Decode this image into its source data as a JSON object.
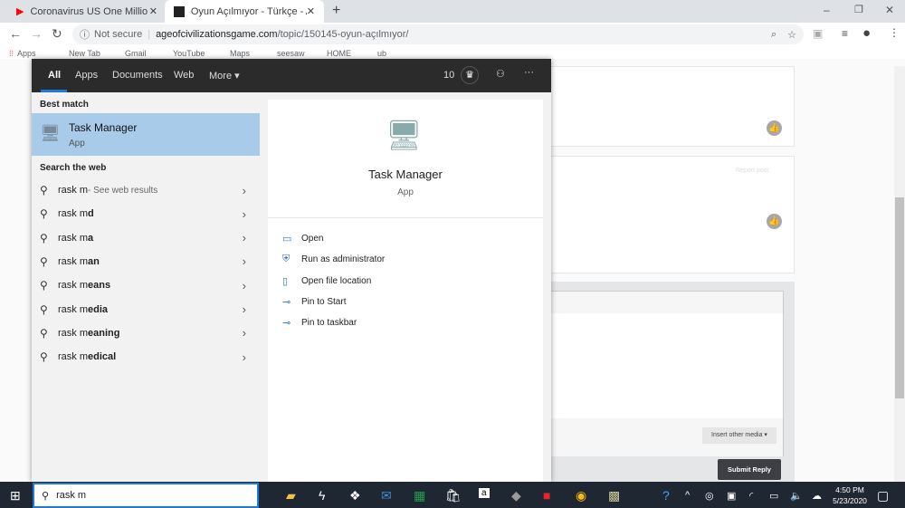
{
  "browser": {
    "tabs": [
      {
        "title": "Coronavirus US One Million Case",
        "icon": "youtube-icon",
        "active": false
      },
      {
        "title": "Oyun Açılmıyor - Türkçe - Age of",
        "icon": "game-icon",
        "active": true
      }
    ],
    "security": "Not secure",
    "url_domain": "ageofcivilizationsgame.com",
    "url_path": "/topic/150145-oyun-açılmıyor/",
    "bookmarks": [
      "Apps",
      "New Tab",
      "Gmail",
      "YouTube",
      "Maps",
      "seesaw",
      "HOME",
      "ub"
    ]
  },
  "page": {
    "report_post": "Report post",
    "insert_media": "Insert other media ▾",
    "submit": "Submit Reply"
  },
  "start": {
    "tabs": [
      "All",
      "Apps",
      "Documents",
      "Web",
      "More ▾"
    ],
    "points": "10",
    "best_match_label": "Best match",
    "best": {
      "name": "Task Manager",
      "type": "App"
    },
    "web_label": "Search the web",
    "web_results": [
      {
        "q": "rask m",
        "bold": "",
        "hint": " - See web results"
      },
      {
        "q": "rask m",
        "bold": "d",
        "hint": ""
      },
      {
        "q": "rask m",
        "bold": "a",
        "hint": ""
      },
      {
        "q": "rask m",
        "bold": "an",
        "hint": ""
      },
      {
        "q": "rask m",
        "bold": "eans",
        "hint": ""
      },
      {
        "q": "rask m",
        "bold": "edia",
        "hint": ""
      },
      {
        "q": "rask m",
        "bold": "eaning",
        "hint": ""
      },
      {
        "q": "rask m",
        "bold": "edical",
        "hint": ""
      }
    ],
    "actions": [
      "Open",
      "Run as administrator",
      "Open file location",
      "Pin to Start",
      "Pin to taskbar"
    ],
    "search_value": "rask m"
  },
  "taskbar": {
    "time": "4:50 PM",
    "date": "5/23/2020"
  },
  "colors": {
    "accent": "#1f7ad6",
    "selection": "#a8cbe9",
    "taskbar": "#1f2733"
  }
}
